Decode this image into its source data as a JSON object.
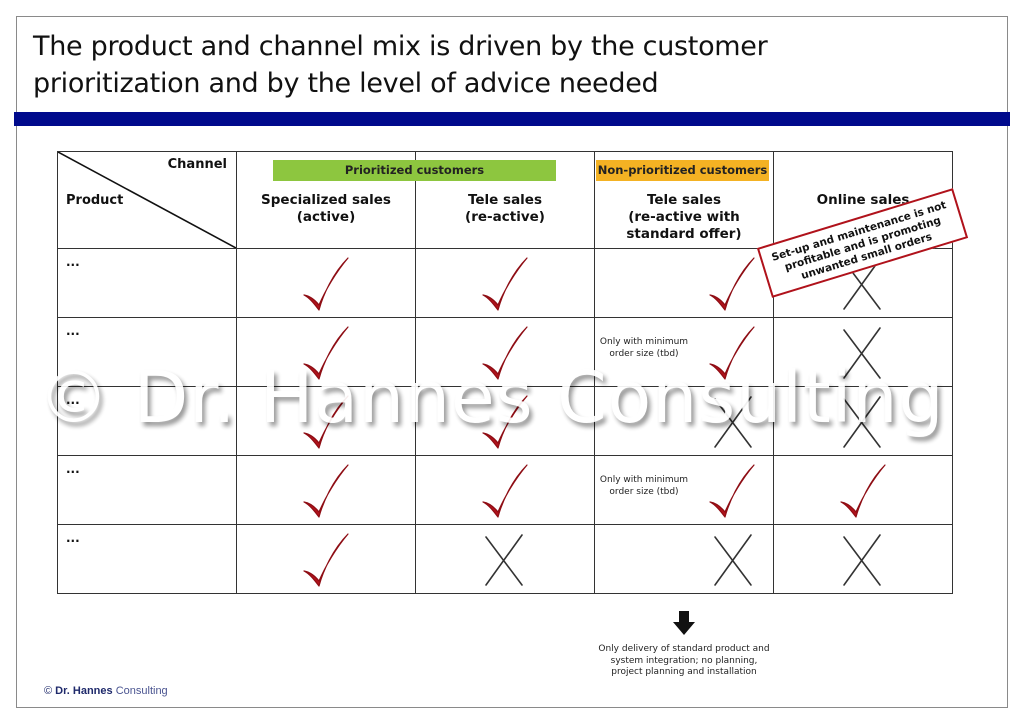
{
  "title": "The product and channel mix is driven by the customer prioritization and by the level of advice needed",
  "colors": {
    "title_bar": "#000a8c",
    "prioritized_band": "#8dc63f",
    "non_prioritized_band": "#f4b223",
    "check": "#b0121b",
    "cross": "#333333",
    "callout_border": "#b0121b"
  },
  "table": {
    "corner": {
      "channel_label": "Channel",
      "product_label": "Product"
    },
    "groups": [
      {
        "label": "Prioritized customers",
        "color": "green"
      },
      {
        "label": "Non-prioritized customers",
        "color": "orange"
      }
    ],
    "columns": [
      {
        "line1": "Specialized sales",
        "line2": "(active)",
        "line3": ""
      },
      {
        "line1": "Tele sales",
        "line2": "(re-active)",
        "line3": ""
      },
      {
        "line1": "Tele sales",
        "line2": "(re-active with",
        "line3": "standard offer)"
      },
      {
        "line1": "Online sales",
        "line2": "",
        "line3": ""
      }
    ],
    "rows": [
      {
        "label": "...",
        "cells": [
          "check",
          "check",
          "check",
          "cross"
        ],
        "notes": [
          "",
          "",
          "",
          ""
        ]
      },
      {
        "label": "...",
        "cells": [
          "check",
          "check",
          "check",
          "cross"
        ],
        "notes": [
          "",
          "",
          "Only with minimum order size (tbd)",
          ""
        ]
      },
      {
        "label": "...",
        "cells": [
          "check",
          "check",
          "cross",
          "cross"
        ],
        "notes": [
          "",
          "",
          "",
          ""
        ]
      },
      {
        "label": "...",
        "cells": [
          "check",
          "check",
          "check",
          "check"
        ],
        "notes": [
          "",
          "",
          "Only with minimum order size (tbd)",
          ""
        ]
      },
      {
        "label": "...",
        "cells": [
          "check",
          "cross",
          "cross",
          "cross"
        ],
        "notes": [
          "",
          "",
          "",
          ""
        ]
      }
    ]
  },
  "callout": "Set-up and maintenance is not profitable and is promoting unwanted small orders",
  "bottom_note": "Only delivery of standard product and system integration; no planning, project planning and installation",
  "footer": {
    "symbol": "©",
    "bold": "Dr. Hannes",
    "light": "Consulting"
  },
  "watermark": "© Dr. Hannes Consulting"
}
